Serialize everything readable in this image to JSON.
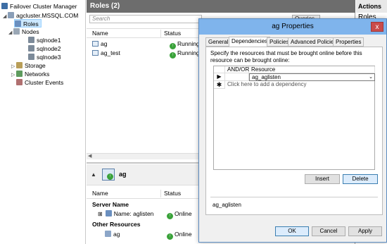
{
  "tree": {
    "root": "Failover Cluster Manager",
    "cluster": "agcluster.MSSQL.COM",
    "roles": "Roles",
    "nodes": "Nodes",
    "node_list": [
      "sqlnode1",
      "sqlnode2",
      "sqlnode3"
    ],
    "storage": "Storage",
    "networks": "Networks",
    "events": "Cluster Events"
  },
  "roles_pane": {
    "title": "Roles (2)",
    "search_placeholder": "Search",
    "query_label": "Queries",
    "columns": [
      "Name",
      "Status"
    ],
    "rows": [
      {
        "name": "ag",
        "status": "Running"
      },
      {
        "name": "ag_test",
        "status": "Running"
      }
    ]
  },
  "detail_pane": {
    "title": "ag",
    "columns": [
      "Name",
      "Status"
    ],
    "groups": [
      {
        "label": "Server Name",
        "items": [
          {
            "name": "Name: aglisten",
            "status": "Online"
          }
        ]
      },
      {
        "label": "Other Resources",
        "items": [
          {
            "name": "ag",
            "status": "Online"
          }
        ]
      }
    ]
  },
  "dialog": {
    "title": "ag Properties",
    "close_label": "x",
    "tabs": [
      "General",
      "Dependencies",
      "Policies",
      "Advanced Policies",
      "Properties"
    ],
    "active_tab": "Dependencies",
    "description": "Specify the resources that must be brought online before this resource can be brought online:",
    "grid": {
      "col_andor": "AND/OR",
      "col_resource": "Resource",
      "resource_value": "ag_aglisten",
      "add_placeholder": "Click here to add a dependency"
    },
    "insert_label": "Insert",
    "delete_label": "Delete",
    "summary": "ag_aglisten",
    "ok_label": "OK",
    "cancel_label": "Cancel",
    "apply_label": "Apply"
  },
  "actions": {
    "title": "Actions",
    "roles": "Roles"
  },
  "colors": {
    "dialog_title": "#7fb4ec",
    "close_button": "#c94b4b",
    "status_ok": "#3aa23a",
    "selection": "#cce8ff"
  }
}
